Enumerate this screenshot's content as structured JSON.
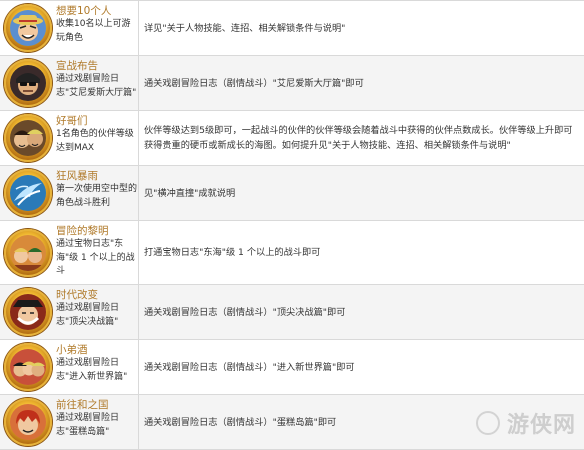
{
  "achievements": [
    {
      "title": "想要10个人",
      "desc": "收集10名以上可游玩角色",
      "detail": "详见\"关于人物技能、连招、相关解锁条件与说明\"",
      "icon": "straw-hat-portrait-icon"
    },
    {
      "title": "宣战布告",
      "desc": "通过戏剧冒险日志\"艾尼爱斯大厅篇\"",
      "detail": "通关戏剧冒险日志（剧情战斗）\"艾尼爱斯大厅篇\"即可",
      "icon": "sunglasses-pirate-portrait-icon"
    },
    {
      "title": "好哥们",
      "desc": "1名角色的伙伴等级达到MAX",
      "detail": "伙伴等级达到5级即可，一起战斗的伙伴的伙伴等级会随着战斗中获得的伙伴点数成长。伙伴等级上升即可获得贵重的硬币或新成长的海图。如何提升见\"关于人物技能、连招、相关解锁条件与说明\"",
      "icon": "two-pirates-portrait-icon"
    },
    {
      "title": "狂风暴雨",
      "desc": "第一次使用空中型的角色战斗胜利",
      "detail": "见\"横冲直撞\"成就说明",
      "icon": "storm-wing-icon"
    },
    {
      "title": "冒险的黎明",
      "desc": "通过宝物日志\"东海\"级 1 个以上的战斗",
      "detail": "打通宝物日志\"东海\"级 1 个以上的战斗即可",
      "icon": "dawn-crew-portrait-icon"
    },
    {
      "title": "时代改变",
      "desc": "通过戏剧冒险日志\"顶尖决战篇\"",
      "detail": "通关戏剧冒险日志（剧情战斗）\"顶尖决战篇\"即可",
      "icon": "captain-portrait-icon"
    },
    {
      "title": "小弟酒",
      "desc": "通过戏剧冒险日志\"进入新世界篇\"",
      "detail": "通关戏剧冒险日志（剧情战斗）\"进入新世界篇\"即可",
      "icon": "brothers-portrait-icon"
    },
    {
      "title": "前往和之国",
      "desc": "通过戏剧冒险日志\"蛋糕岛篇\"",
      "detail": "通关戏剧冒险日志（剧情战斗）\"蛋糕岛篇\"即可",
      "icon": "red-hair-portrait-icon"
    }
  ],
  "watermark": "游侠网",
  "colors": {
    "title": "#b07a2a",
    "border": "#d9d9d9",
    "row_alt": "#f4f4f4",
    "text": "#333333"
  }
}
